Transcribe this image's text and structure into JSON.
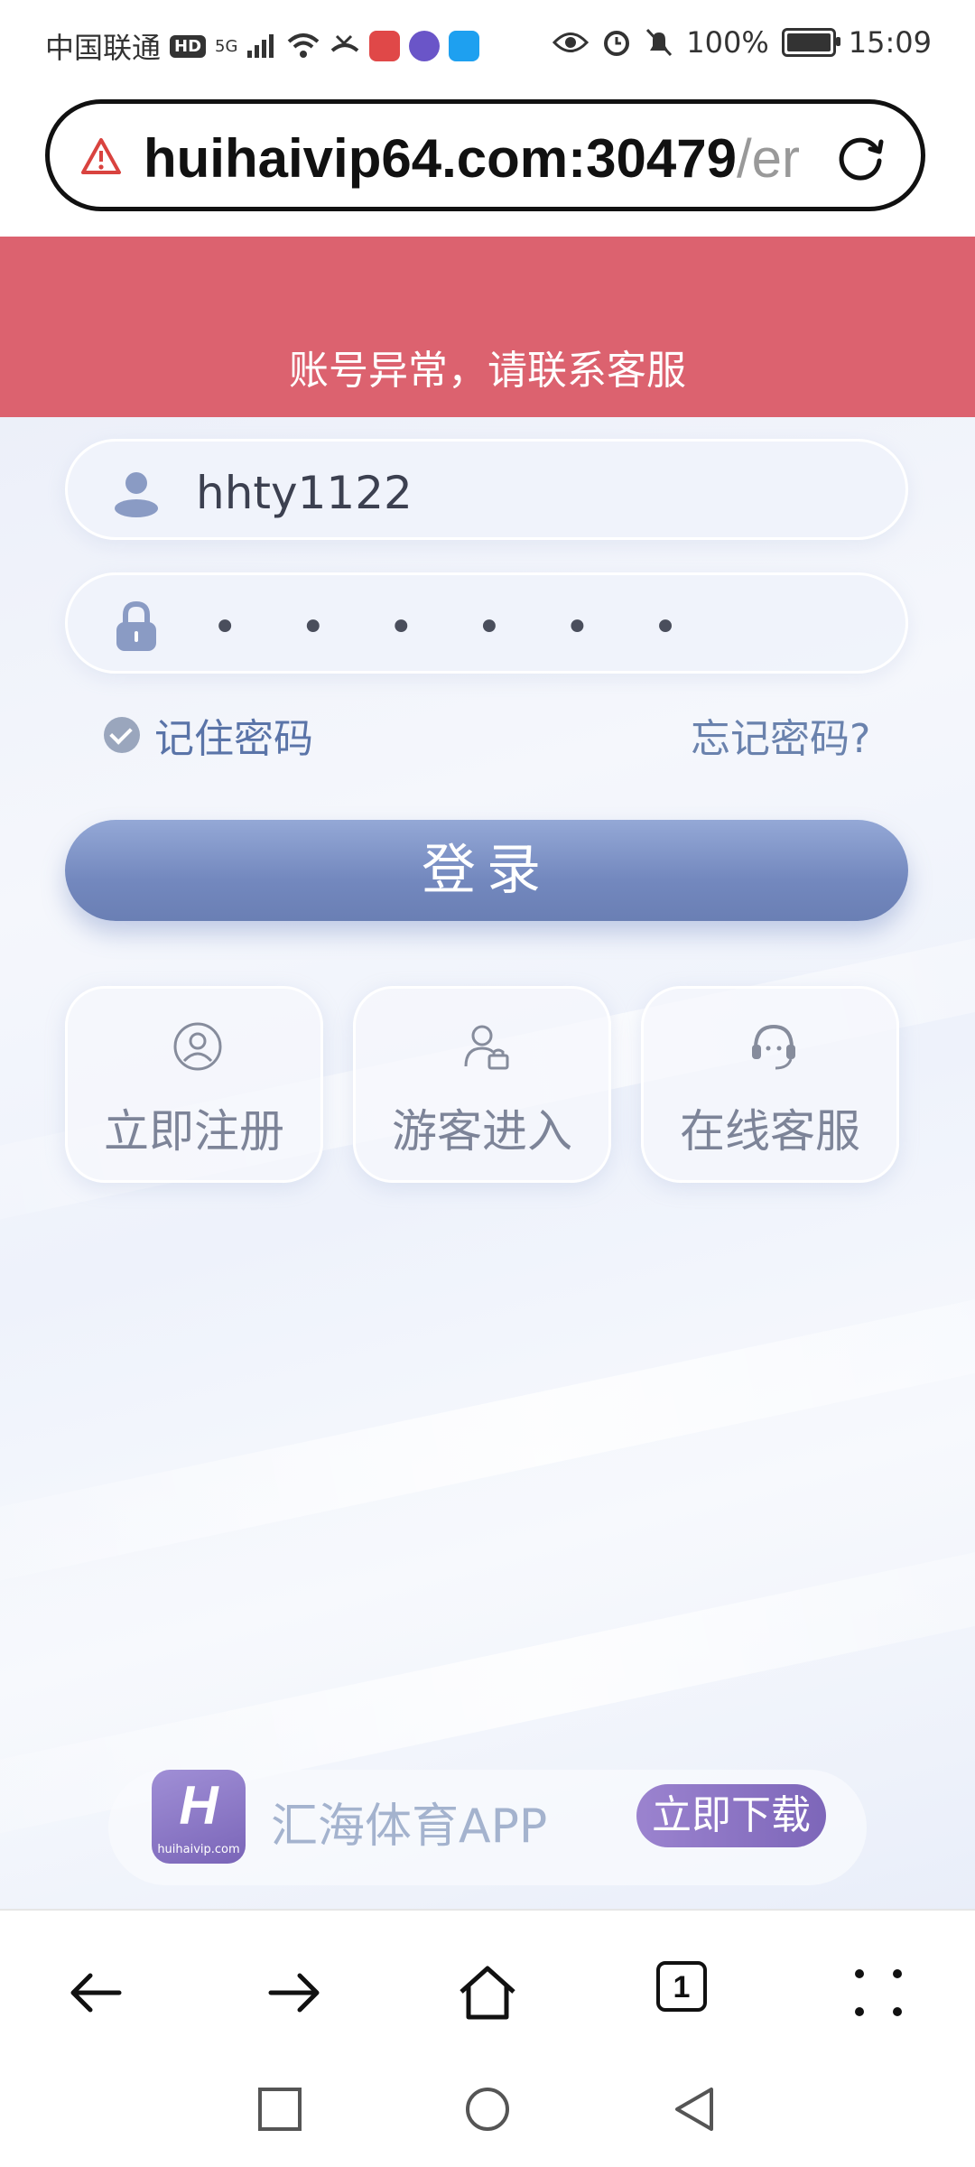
{
  "status_bar": {
    "carrier": "中国联通",
    "hd": "HD",
    "network": "5G",
    "battery": "100%",
    "time": "15:09"
  },
  "browser": {
    "url_host": "huihaivip64.com:30479",
    "url_path": "/er",
    "tab_count": "1"
  },
  "alert": {
    "message": "账号异常，请联系客服"
  },
  "login": {
    "username": "hhty1122",
    "password_mask": "• • • • • • • • • •",
    "remember_label": "记住密码",
    "forgot_label": "忘记密码?",
    "login_button": "登录"
  },
  "quick_actions": [
    {
      "label": "立即注册",
      "icon": "user-circle-icon"
    },
    {
      "label": "游客进入",
      "icon": "guest-icon"
    },
    {
      "label": "在线客服",
      "icon": "headset-icon"
    }
  ],
  "promo": {
    "logo_letter": "H",
    "logo_domain": "huihaivip.com",
    "title": "汇海体育APP",
    "download_label": "立即下载"
  },
  "colors": {
    "alert_bg": "#dc626f",
    "login_button": "#7388be",
    "promo_accent": "#8a74c4"
  }
}
